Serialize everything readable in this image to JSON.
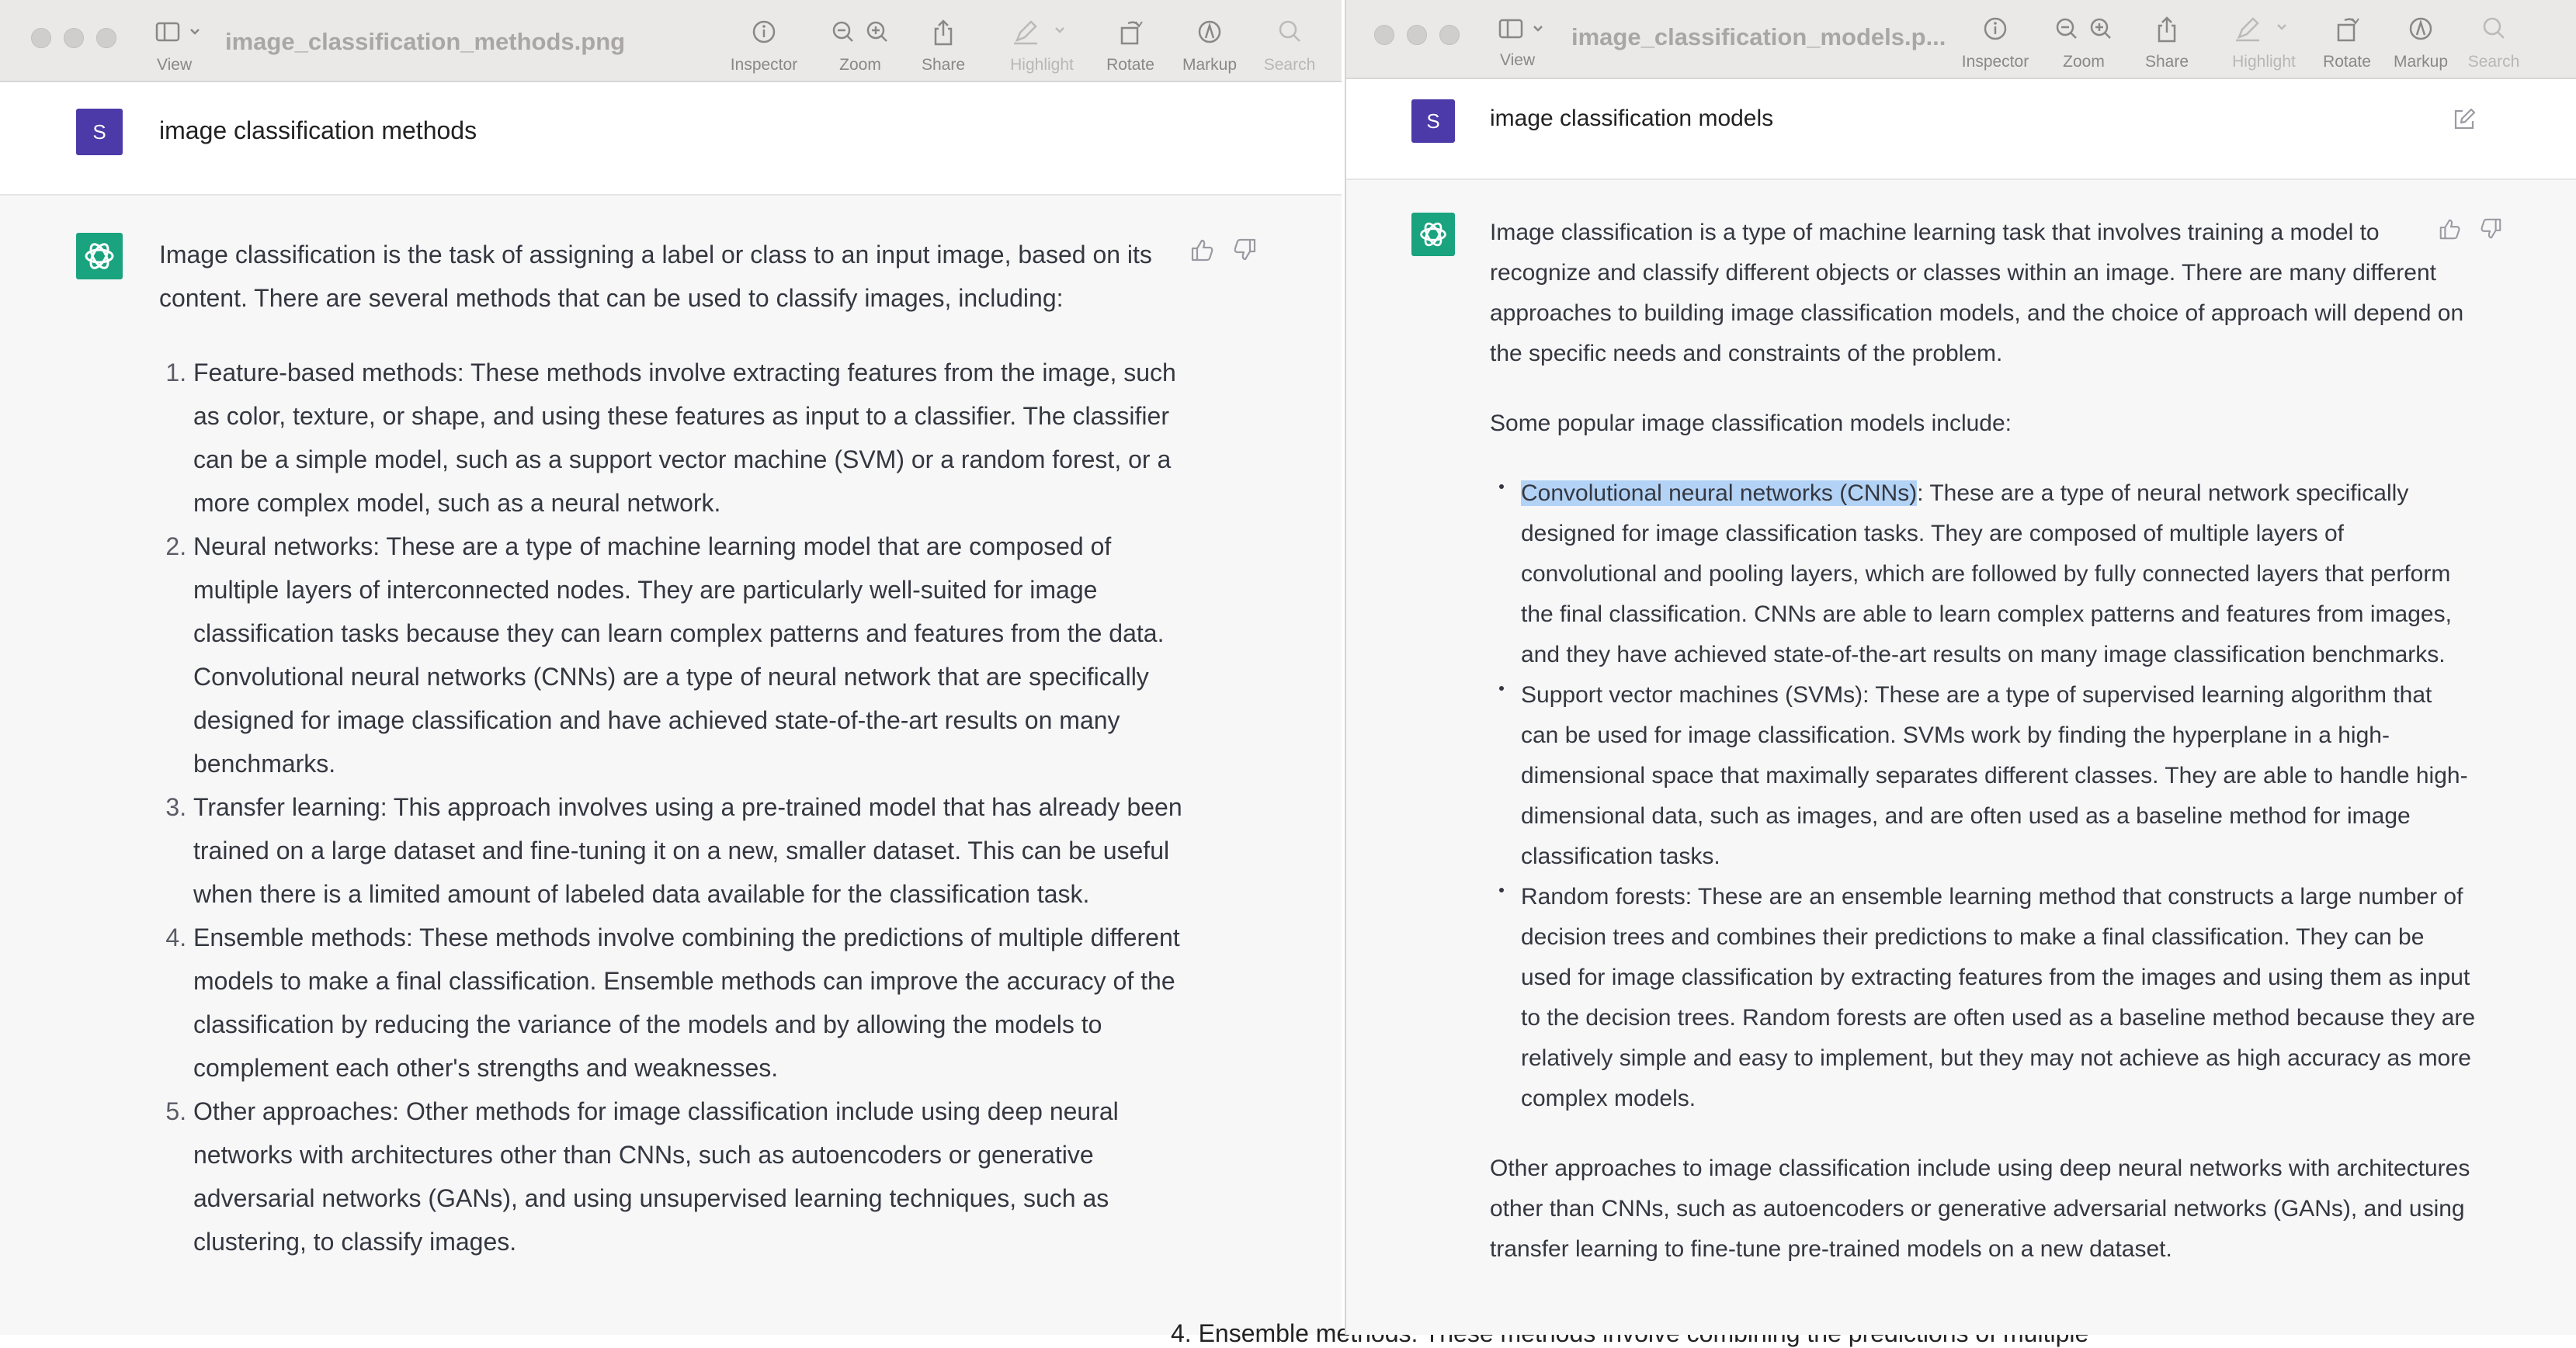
{
  "left_window": {
    "title": "image_classification_methods.png",
    "view_label": "View",
    "toolbar": [
      {
        "label": "Inspector",
        "icon": "info-icon"
      },
      {
        "label": "Zoom",
        "icon": "zoom-icon"
      },
      {
        "label": "Share",
        "icon": "share-icon"
      },
      {
        "label": "Highlight",
        "icon": "highlight-icon"
      },
      {
        "label": "Rotate",
        "icon": "rotate-icon"
      },
      {
        "label": "Markup",
        "icon": "markup-icon"
      },
      {
        "label": "Search",
        "icon": "search-icon"
      }
    ],
    "user_initial": "S",
    "prompt": "image classification methods",
    "intro": "Image classification is the task of assigning a label or class to an input image, based on its content. There are several methods that can be used to classify images, including:",
    "items": [
      "Feature-based methods: These methods involve extracting features from the image, such as color, texture, or shape, and using these features as input to a classifier. The classifier can be a simple model, such as a support vector machine (SVM) or a random forest, or a more complex model, such as a neural network.",
      "Neural networks: These are a type of machine learning model that are composed of multiple layers of interconnected nodes. They are particularly well-suited for image classification tasks because they can learn complex patterns and features from the data. Convolutional neural networks (CNNs) are a type of neural network that are specifically designed for image classification and have achieved state-of-the-art results on many benchmarks.",
      "Transfer learning: This approach involves using a pre-trained model that has already been trained on a large dataset and fine-tuning it on a new, smaller dataset. This can be useful when there is a limited amount of labeled data available for the classification task.",
      "Ensemble methods: These methods involve combining the predictions of multiple different models to make a final classification. Ensemble methods can improve the accuracy of the classification by reducing the variance of the models and by allowing the models to complement each other's strengths and weaknesses.",
      "Other approaches: Other methods for image classification include using deep neural networks with architectures other than CNNs, such as autoencoders or generative adversarial networks (GANs), and using unsupervised learning techniques, such as clustering, to classify images."
    ]
  },
  "right_window": {
    "title": "image_classification_models.p...",
    "view_label": "View",
    "toolbar": [
      {
        "label": "Inspector",
        "icon": "info-icon"
      },
      {
        "label": "Zoom",
        "icon": "zoom-icon"
      },
      {
        "label": "Share",
        "icon": "share-icon"
      },
      {
        "label": "Highlight",
        "icon": "highlight-icon"
      },
      {
        "label": "Rotate",
        "icon": "rotate-icon"
      },
      {
        "label": "Markup",
        "icon": "markup-icon"
      },
      {
        "label": "Search",
        "icon": "search-icon"
      }
    ],
    "user_initial": "S",
    "prompt": "image classification models",
    "intro": "Image classification is a type of machine learning task that involves training a model to recognize and classify different objects or classes within an image. There are many different approaches to building image classification models, and the choice of approach will depend on the specific needs and constraints of the problem.",
    "lead": "Some popular image classification models include:",
    "bullets": [
      {
        "highlight": "Convolutional neural networks (CNNs)",
        "text": ": These are a type of neural network specifically designed for image classification tasks. They are composed of multiple layers of convolutional and pooling layers, which are followed by fully connected layers that perform the final classification. CNNs are able to learn complex patterns and features from images, and they have achieved state-of-the-art results on many image classification benchmarks."
      },
      {
        "highlight": "",
        "text": "Support vector machines (SVMs): These are a type of supervised learning algorithm that can be used for image classification. SVMs work by finding the hyperplane in a high-dimensional space that maximally separates different classes. They are able to handle high-dimensional data, such as images, and are often used as a baseline method for image classification tasks."
      },
      {
        "highlight": "",
        "text": "Random forests: These are an ensemble learning method that constructs a large number of decision trees and combines their predictions to make a final classification. They can be used for image classification by extracting features from the images and using them as input to the decision trees. Random forests are often used as a baseline method because they are relatively simple and easy to implement, but they may not achieve as high accuracy as more complex models."
      }
    ],
    "closing": "Other approaches to image classification include using deep neural networks with architectures other than CNNs, such as autoencoders or generative adversarial networks (GANs), and using transfer learning to fine-tune pre-trained models on a new dataset."
  },
  "background_peek_text": "4. Ensemble methods: These methods involve combining the predictions of multiple"
}
